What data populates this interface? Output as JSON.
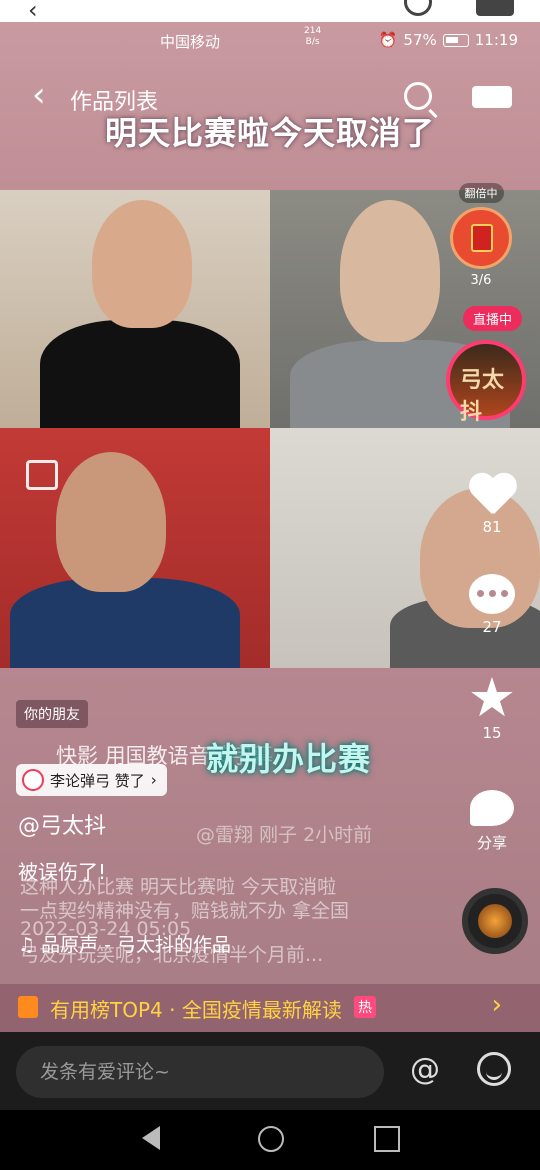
{
  "status_bar": {
    "carrier": "中国移动",
    "net_speed": "214",
    "net_unit": "B/s",
    "battery": "57%",
    "time": "11:19"
  },
  "nav": {
    "title": "作品列表"
  },
  "video": {
    "banner_text": "明天比赛啦今天取消了",
    "mid_banner": "就别办比赛"
  },
  "reward": {
    "tag": "翻倍中",
    "progress": "3/6"
  },
  "live": {
    "tag": "直播中",
    "avatar_text": "弓太抖"
  },
  "actions": {
    "likes": "81",
    "comments": "27",
    "favorites": "15",
    "share": "分享"
  },
  "caption": {
    "friend_tag": "你的朋友",
    "like_notice": "李论弹弓 赞了",
    "handle": "@弓太抖",
    "text": "被误伤了!",
    "music": "品原声 - 弓太抖的作品",
    "ghost_line1": "快影 用国教语音转字幕",
    "ghost_line2": "@雷翔 刚子 2小时前",
    "ghost_line3": "这种人办比赛 明天比赛啦 今天取消啦",
    "ghost_line4": "一点契约精神没有，赔钱就不办 拿全国",
    "ghost_line5": "2022-03-24 05:05",
    "ghost_line6": "弓友开玩笑呢，北京疫情半个月前..."
  },
  "hotbar": {
    "text": "有用榜TOP4 · 全国疫情最新解读",
    "badge": "热"
  },
  "comment": {
    "placeholder": "发条有爱评论~"
  }
}
